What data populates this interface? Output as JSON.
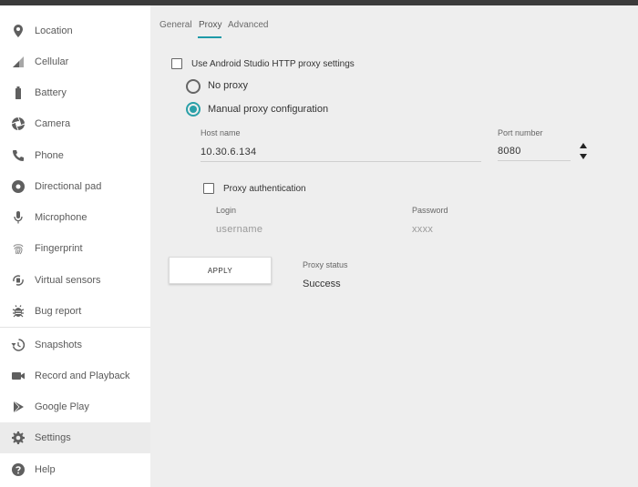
{
  "sidebar": {
    "items": [
      {
        "label": "Location",
        "icon": "location-icon"
      },
      {
        "label": "Cellular",
        "icon": "cellular-icon"
      },
      {
        "label": "Battery",
        "icon": "battery-icon"
      },
      {
        "label": "Camera",
        "icon": "camera-icon"
      },
      {
        "label": "Phone",
        "icon": "phone-icon"
      },
      {
        "label": "Directional pad",
        "icon": "dpad-icon"
      },
      {
        "label": "Microphone",
        "icon": "microphone-icon"
      },
      {
        "label": "Fingerprint",
        "icon": "fingerprint-icon"
      },
      {
        "label": "Virtual sensors",
        "icon": "rotation-icon"
      },
      {
        "label": "Bug report",
        "icon": "bug-icon"
      },
      {
        "label": "Snapshots",
        "icon": "history-icon"
      },
      {
        "label": "Record and Playback",
        "icon": "video-camera-icon"
      },
      {
        "label": "Google Play",
        "icon": "play-icon"
      },
      {
        "label": "Settings",
        "icon": "gear-icon",
        "selected": true
      },
      {
        "label": "Help",
        "icon": "help-icon"
      }
    ]
  },
  "tabs": {
    "general": "General",
    "proxy": "Proxy",
    "advanced": "Advanced",
    "active": "Proxy"
  },
  "proxy": {
    "use_studio_label": "Use Android Studio HTTP proxy settings",
    "use_studio_checked": false,
    "no_proxy_label": "No proxy",
    "manual_label": "Manual proxy configuration",
    "selected_mode": "manual",
    "host_label": "Host name",
    "host_value": "10.30.6.134",
    "port_label": "Port number",
    "port_value": "8080",
    "auth_label": "Proxy authentication",
    "auth_checked": false,
    "login_label": "Login",
    "login_placeholder": "username",
    "password_label": "Password",
    "password_placeholder": "xxxx",
    "apply_label": "APPLY",
    "status_label": "Proxy status",
    "status_value": "Success"
  },
  "colors": {
    "accent": "#2aa0a8",
    "sidebar_bg": "#ffffff",
    "content_bg": "#eeeeee"
  }
}
